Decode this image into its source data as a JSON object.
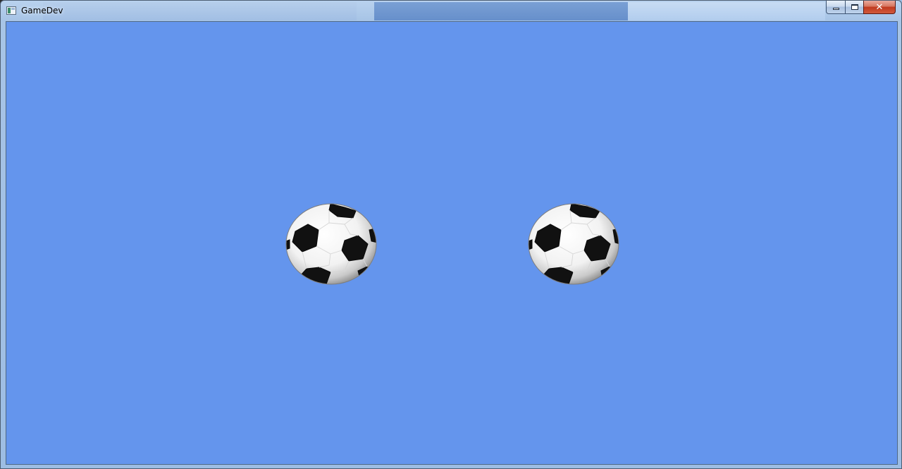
{
  "window": {
    "title": "GameDev",
    "app_icon": "window-app-icon",
    "controls": {
      "minimize_icon": "minimize-icon",
      "maximize_icon": "maximize-icon",
      "close_icon": "close-icon",
      "close_glyph": "✕"
    }
  },
  "scene": {
    "background_color": "#6495ed",
    "objects": [
      {
        "type": "soccer-ball"
      },
      {
        "type": "soccer-ball"
      }
    ]
  }
}
